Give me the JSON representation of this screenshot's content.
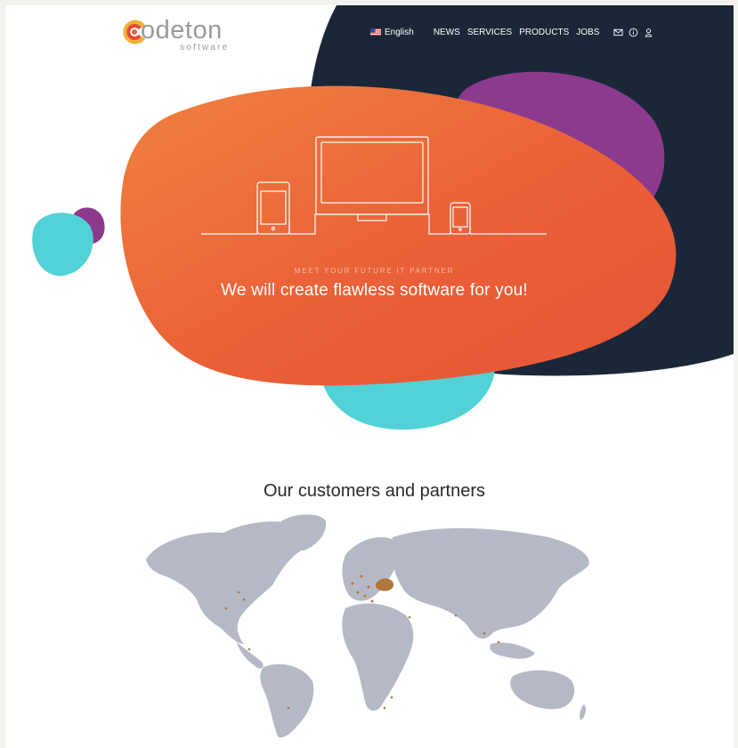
{
  "brand": {
    "name": "odeton",
    "sub": "software",
    "colors": {
      "orange": "#ec6337",
      "yellow": "#f2b137",
      "red": "#e6483a"
    }
  },
  "nav": {
    "language": "English",
    "items": [
      "NEWS",
      "SERVICES",
      "PRODUCTS",
      "JOBS"
    ],
    "icons": [
      "mail-icon",
      "info-icon",
      "user-icon"
    ]
  },
  "hero": {
    "tagline": "MEET YOUR FUTURE IT PARTNER",
    "title": "We will create flawless software for you!",
    "colors": {
      "blob": "#ec6337",
      "dark": "#1b2638",
      "purple": "#8b3a8d",
      "teal": "#52d2d7"
    }
  },
  "partners": {
    "title": "Our customers and partners",
    "map_color": "#b5b9c6",
    "marker_color": "#b0763a"
  }
}
